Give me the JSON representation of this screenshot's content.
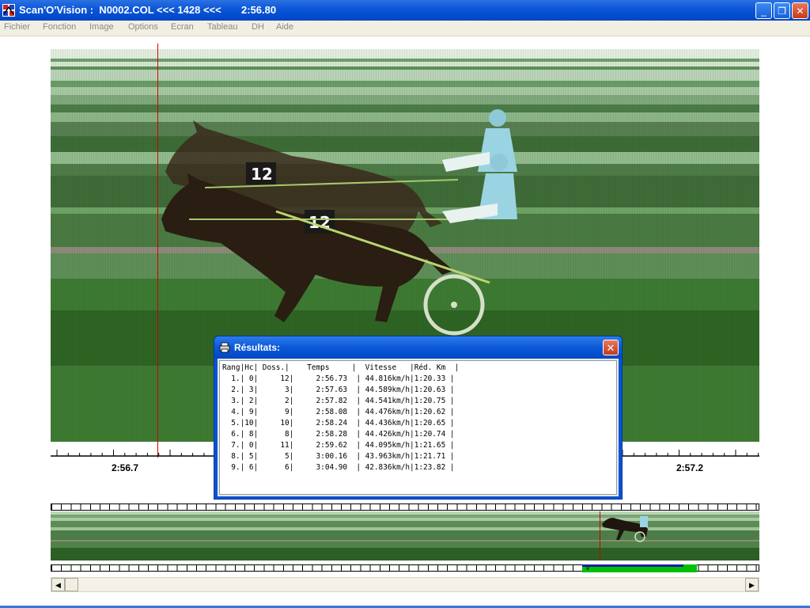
{
  "window": {
    "title": "Scan'O'Vision :  N0002.COL <<< 1428 <<<       2:56.80",
    "minimize": "_",
    "restore": "❐",
    "close": "✕"
  },
  "menu": [
    "Fichier",
    "Fonction",
    "Image",
    "Options",
    "Ecran",
    "Tableau",
    "DH",
    "Aide"
  ],
  "photo": {
    "saddle_cloth_1": "12",
    "saddle_cloth_2": "12"
  },
  "time_scale": {
    "left_label": "2:56.7",
    "right_label": "2:57.2"
  },
  "results_dialog": {
    "title": "Résultats:",
    "close": "✕",
    "header": "Rang|Hc| Doss.|    Temps     |  Vitesse   |Réd. Km  |",
    "rows": [
      "  1.| 0|     12|     2:56.73  | 44.816km/h|1:20.33 |",
      "  2.| 3|      3|     2:57.63  | 44.589km/h|1:20.63 |",
      "  3.| 2|      2|     2:57.82  | 44.541km/h|1:20.75 |",
      "  4.| 9|      9|     2:58.08  | 44.476km/h|1:20.62 |",
      "  5.|10|     10|     2:58.24  | 44.436km/h|1:20.65 |",
      "  6.| 8|      8|     2:58.28  | 44.426km/h|1:20.74 |",
      "  7.| 0|     11|     2:59.62  | 44.095km/h|1:21.65 |",
      "  8.| 5|      5|     3:00.16  | 43.963km/h|1:21.71 |",
      "  9.| 6|      6|     3:04.90  | 42.836km/h|1:23.82 |"
    ]
  },
  "overview": {
    "selection_marker": "v"
  },
  "scrollbar": {
    "left_arrow": "◀",
    "right_arrow": "▶"
  }
}
